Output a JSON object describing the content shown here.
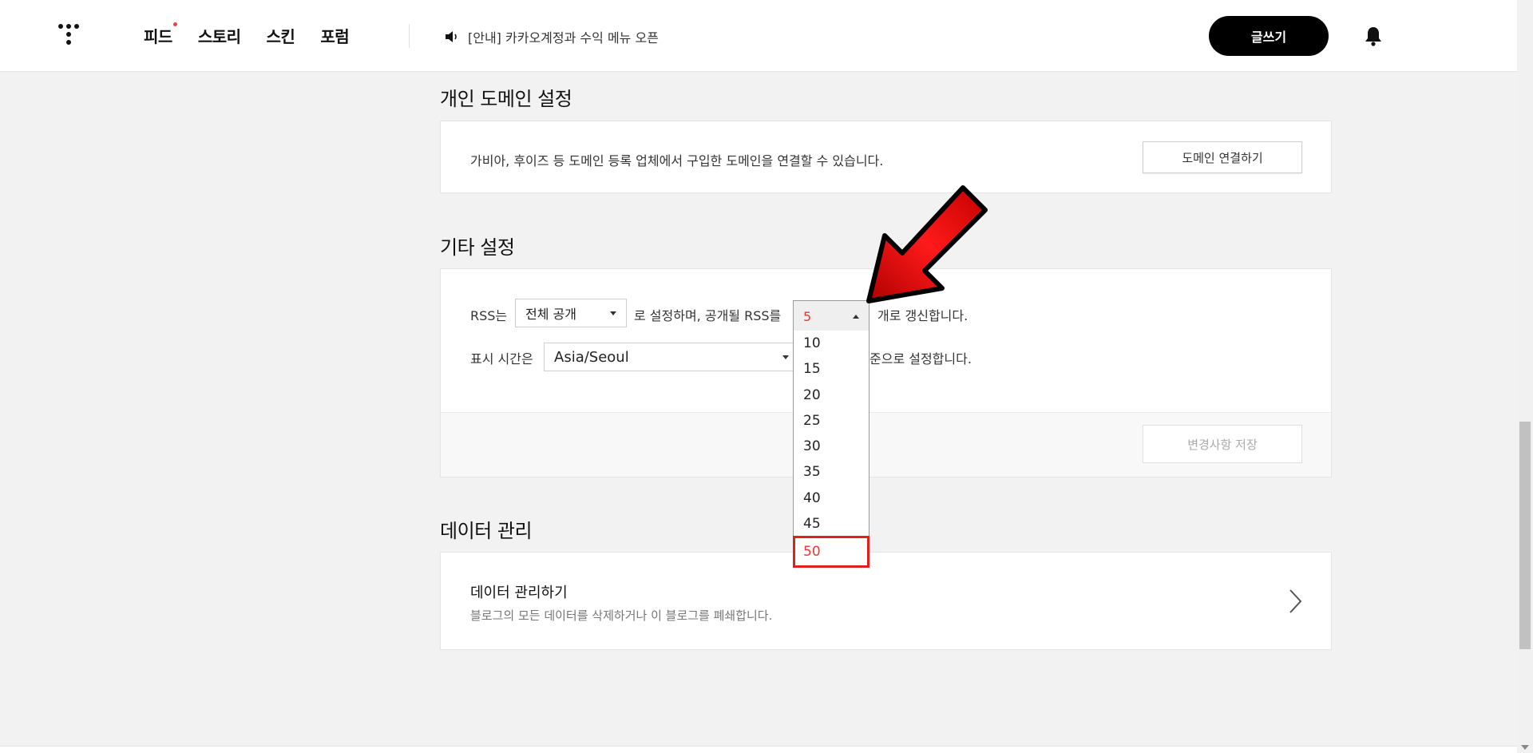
{
  "nav": {
    "items": [
      "피드",
      "스토리",
      "스킨",
      "포럼"
    ]
  },
  "notice": {
    "text": "[안내] 카카오계정과 수익 메뉴 오픈"
  },
  "header": {
    "write_label": "글쓰기"
  },
  "domain_section": {
    "title": "개인 도메인 설정",
    "description": "가비아, 후이즈 등 도메인 등록 업체에서 구입한 도메인을 연결할 수 있습니다.",
    "button_label": "도메인 연결하기"
  },
  "other_section": {
    "title": "기타 설정",
    "rss_prefix": "RSS는",
    "rss_visibility_value": "전체 공개",
    "rss_middle": "로 설정하며, 공개될 RSS를",
    "rss_suffix": "개로 갱신합니다.",
    "time_prefix": "표시 시간은",
    "timezone_value": "Asia/Seoul",
    "time_suffix": "준으로 설정합니다.",
    "save_label": "변경사항 저장",
    "rss_count": {
      "current": "5",
      "options": [
        "10",
        "15",
        "20",
        "25",
        "30",
        "35",
        "40",
        "45"
      ],
      "highlighted": "50"
    }
  },
  "data_section": {
    "title": "데이터 관리",
    "card_title": "데이터 관리하기",
    "card_desc": "블로그의 모든 데이터를 삭제하거나 이 블로그를 폐쇄합니다."
  },
  "colors": {
    "accent_red": "#e53935",
    "annotation_red": "#e02020"
  }
}
